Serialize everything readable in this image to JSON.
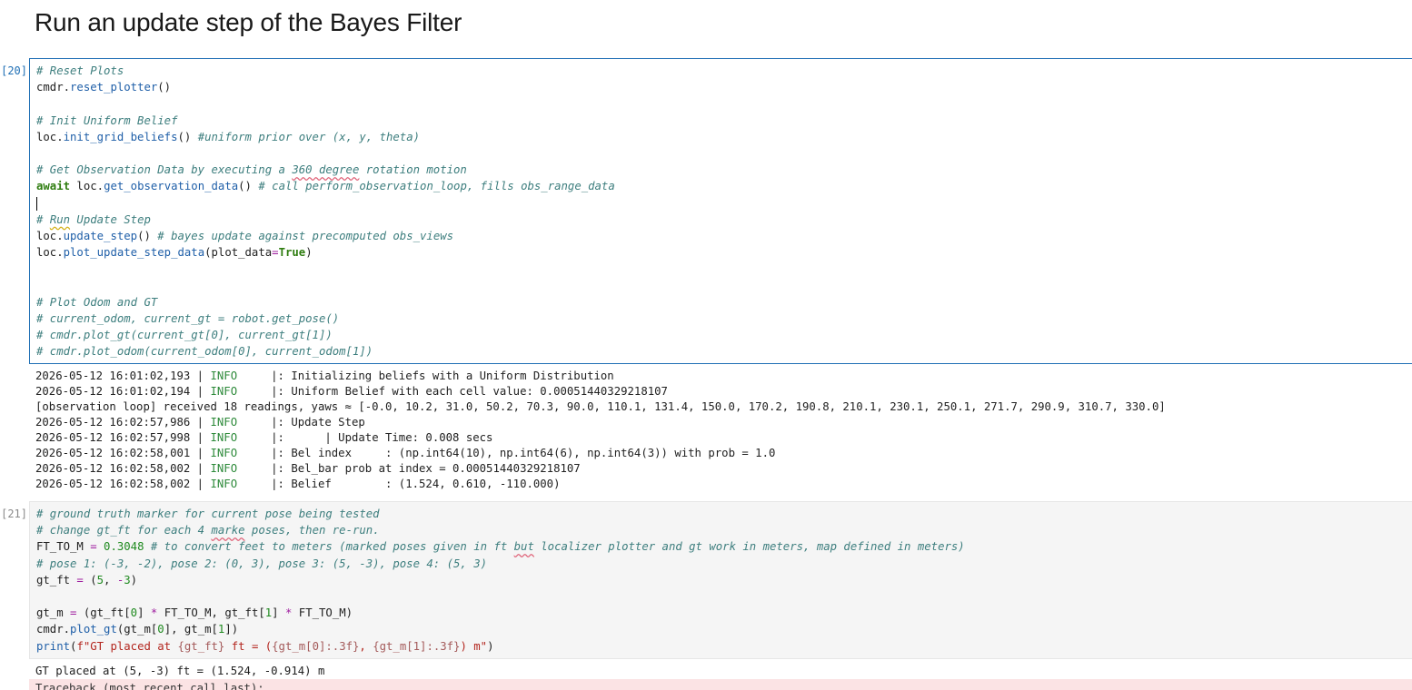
{
  "heading": "Run an update step of the Bayes Filter",
  "cell20": {
    "prompt": "[20]:",
    "code": [
      "# Reset Plots",
      "cmdr.reset_plotter()",
      "",
      "# Init Uniform Belief",
      "loc.init_grid_beliefs() #uniform prior over (x, y, theta)",
      "",
      "# Get Observation Data by executing a 360 degree rotation motion",
      "await loc.get_observation_data() # call perform_observation_loop, fills obs_range_data",
      "",
      "# Run Update Step",
      "loc.update_step() # bayes update against precomputed obs_views",
      "loc.plot_update_step_data(plot_data=True)",
      "",
      "",
      "# Plot Odom and GT",
      "# current_odom, current_gt = robot.get_pose()",
      "# cmdr.plot_gt(current_gt[0], current_gt[1])",
      "# cmdr.plot_odom(current_odom[0], current_odom[1])"
    ],
    "output": [
      "2026-05-12 16:01:02,193 | INFO     |: Initializing beliefs with a Uniform Distribution",
      "2026-05-12 16:01:02,194 | INFO     |: Uniform Belief with each cell value: 0.00051440329218107",
      "[observation loop] received 18 readings, yaws ≈ [-0.0, 10.2, 31.0, 50.2, 70.3, 90.0, 110.1, 131.4, 150.0, 170.2, 190.8, 210.1, 230.1, 250.1, 271.7, 290.9, 310.7, 330.0]",
      "2026-05-12 16:02:57,986 | INFO     |: Update Step",
      "2026-05-12 16:02:57,998 | INFO     |:      | Update Time: 0.008 secs",
      "2026-05-12 16:02:58,001 | INFO     |: Bel index     : (np.int64(10), np.int64(6), np.int64(3)) with prob = 1.0",
      "2026-05-12 16:02:58,002 | INFO     |: Bel_bar prob at index = 0.00051440329218107",
      "2026-05-12 16:02:58,002 | INFO     |: Belief        : (1.524, 0.610, -110.000)"
    ]
  },
  "cell21": {
    "prompt": "[21]:",
    "code": [
      "# ground truth marker for current pose being tested",
      "# change gt_ft for each 4 marke poses, then re-run.",
      "FT_TO_M = 0.3048 # to convert feet to meters (marked poses given in ft but localizer plotter and gt work in meters, map defined in meters)",
      "# pose 1: (-3, -2), pose 2: (0, 3), pose 3: (5, -3), pose 4: (5, 3)",
      "gt_ft = (5, -3)",
      "",
      "gt_m = (gt_ft[0] * FT_TO_M, gt_ft[1] * FT_TO_M)",
      "cmdr.plot_gt(gt_m[0], gt_m[1])",
      "print(f\"GT placed at {gt_ft} ft = ({gt_m[0]:.3f}, {gt_m[1]:.3f}) m\")"
    ],
    "output": [
      "GT placed at (5, -3) ft = (1.524, -0.914) m"
    ],
    "traceback": "Traceback (most recent call last):"
  }
}
